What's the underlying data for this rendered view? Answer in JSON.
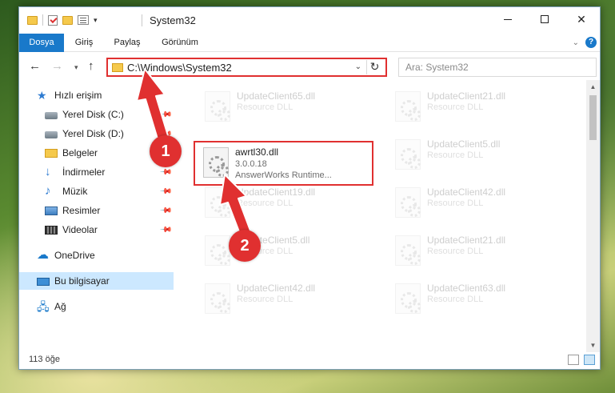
{
  "window": {
    "title": "System32"
  },
  "ribbon": {
    "tabs": [
      "Dosya",
      "Giriş",
      "Paylaş",
      "Görünüm"
    ],
    "help_label": "?"
  },
  "navigation": {
    "address": "C:\\Windows\\System32",
    "search_placeholder": "Ara: System32"
  },
  "sidebar": {
    "items": [
      {
        "label": "Hızlı erişim",
        "icon": "star-icon",
        "pinned": false
      },
      {
        "label": "Yerel Disk (C:)",
        "icon": "drive-icon",
        "pinned": true
      },
      {
        "label": "Yerel Disk (D:)",
        "icon": "drive-icon",
        "pinned": true
      },
      {
        "label": "Belgeler",
        "icon": "documents-icon",
        "pinned": true
      },
      {
        "label": "İndirmeler",
        "icon": "download-icon",
        "pinned": true
      },
      {
        "label": "Müzik",
        "icon": "music-icon",
        "pinned": true
      },
      {
        "label": "Resimler",
        "icon": "pictures-icon",
        "pinned": true
      },
      {
        "label": "Videolar",
        "icon": "videos-icon",
        "pinned": true
      },
      {
        "label": "OneDrive",
        "icon": "cloud-icon",
        "pinned": false
      },
      {
        "label": "Bu bilgisayar",
        "icon": "computer-icon",
        "pinned": false,
        "selected": true
      },
      {
        "label": "Ağ",
        "icon": "network-icon",
        "pinned": false
      }
    ]
  },
  "files": {
    "left_column": [
      {
        "name": "UpdateClient65.dll",
        "type": "Resource DLL"
      },
      {
        "name": "awrtl30.dll",
        "version": "3.0.0.18",
        "description": "AnswerWorks Runtime..."
      },
      {
        "name": "UpdateClient19.dll",
        "type": "Resource DLL"
      },
      {
        "name": "UpdateClient5.dll",
        "type": "Resource DLL"
      },
      {
        "name": "UpdateClient42.dll",
        "type": "Resource DLL"
      }
    ],
    "right_column": [
      {
        "name": "UpdateClient21.dll",
        "type": "Resource DLL"
      },
      {
        "name": "UpdateClient5.dll",
        "type": "Resource DLL"
      },
      {
        "name": "UpdateClient42.dll",
        "type": "Resource DLL"
      },
      {
        "name": "UpdateClient21.dll",
        "type": "Resource DLL"
      },
      {
        "name": "UpdateClient63.dll",
        "type": "Resource DLL"
      }
    ]
  },
  "status": {
    "item_count": "113 öğe"
  },
  "annotations": {
    "step1": "1",
    "step2": "2",
    "color": "#e03030"
  }
}
